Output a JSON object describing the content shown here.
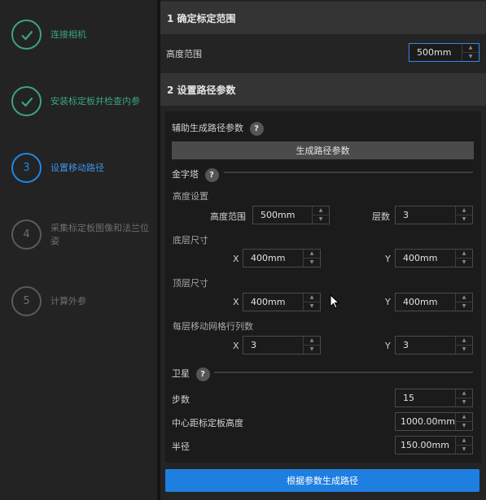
{
  "steps": [
    {
      "number": "1",
      "label": "连接相机",
      "state": "done"
    },
    {
      "number": "2",
      "label": "安装标定板并检查内参",
      "state": "done"
    },
    {
      "number": "3",
      "label": "设置移动路径",
      "state": "current"
    },
    {
      "number": "4",
      "label": "采集标定板图像和法兰位姿",
      "state": "todo"
    },
    {
      "number": "5",
      "label": "计算外参",
      "state": "todo"
    }
  ],
  "section1": {
    "title": "1 确定标定范围",
    "height_range_label": "高度范围",
    "height_range_value": "500mm"
  },
  "section2": {
    "title": "2 设置路径参数",
    "assist_label": "辅助生成路径参数",
    "generate_params_button": "生成路径参数",
    "pyramid": {
      "title": "金字塔",
      "height_settings_label": "高度设置",
      "height_range_label": "高度范围",
      "height_range_value": "500mm",
      "layers_label": "层数",
      "layers_value": "3",
      "bottom_size_label": "底层尺寸",
      "bottom_x_label": "X",
      "bottom_x_value": "400mm",
      "bottom_y_label": "Y",
      "bottom_y_value": "400mm",
      "top_size_label": "顶层尺寸",
      "top_x_label": "X",
      "top_x_value": "400mm",
      "top_y_label": "Y",
      "top_y_value": "400mm",
      "grid_label": "每层移动网格行列数",
      "grid_x_label": "X",
      "grid_x_value": "3",
      "grid_y_label": "Y",
      "grid_y_value": "3"
    },
    "satellite": {
      "title": "卫星",
      "steps_label": "步数",
      "steps_value": "15",
      "center_height_label": "中心距标定板高度",
      "center_height_value": "1000.00mm",
      "radius_label": "半径",
      "radius_value": "150.00mm"
    },
    "generate_path_button": "根据参数生成路径"
  },
  "icons": {
    "check": "check-icon",
    "help": "help-icon",
    "spin_up": "▲",
    "spin_down": "▼",
    "help_glyph": "?"
  },
  "colors": {
    "done": "#3aa57d",
    "current": "#1e88e5",
    "todo": "#5a5a5a",
    "primary_button": "#1f7fe0"
  }
}
